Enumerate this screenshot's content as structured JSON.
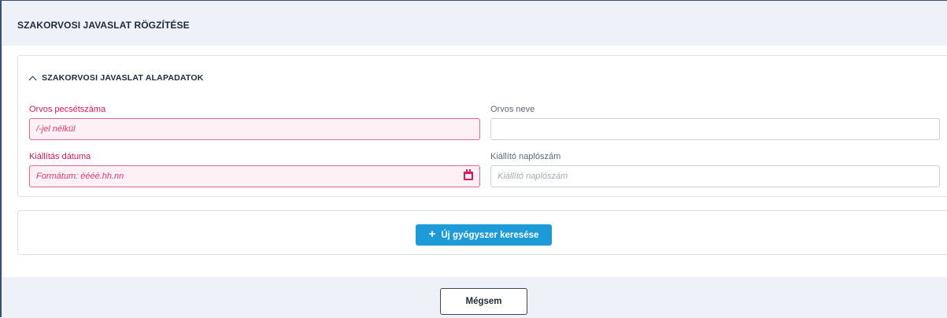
{
  "header": {
    "title": "SZAKORVOSI JAVASLAT RÖGZÍTÉSE"
  },
  "section": {
    "title": "SZAKORVOSI JAVASLAT ALAPADATOK",
    "expanded": true
  },
  "fields": {
    "stamp_number": {
      "label": "Orvos pecsétszáma",
      "placeholder": "/-jel nélkül",
      "value": "",
      "required": true,
      "invalid": true
    },
    "doctor_name": {
      "label": "Orvos neve",
      "placeholder": "",
      "value": ""
    },
    "issue_date": {
      "label": "Kiállítás dátuma",
      "placeholder": "Formátum: éééé.hh.nn",
      "value": "",
      "required": true,
      "invalid": true,
      "icon": "calendar-icon"
    },
    "issuer_log_number": {
      "label": "Kiállító naplószám",
      "placeholder": "Kiállító naplószám",
      "value": ""
    }
  },
  "search": {
    "button_label": "Új gyógyszer keresése",
    "button_icon": "plus-icon"
  },
  "footer": {
    "cancel_label": "Mégsem"
  },
  "colors": {
    "accent": "#1d9bd9",
    "error": "#e2185b",
    "header_bg": "#eef1f7",
    "frame_border": "#3b4f6e"
  }
}
